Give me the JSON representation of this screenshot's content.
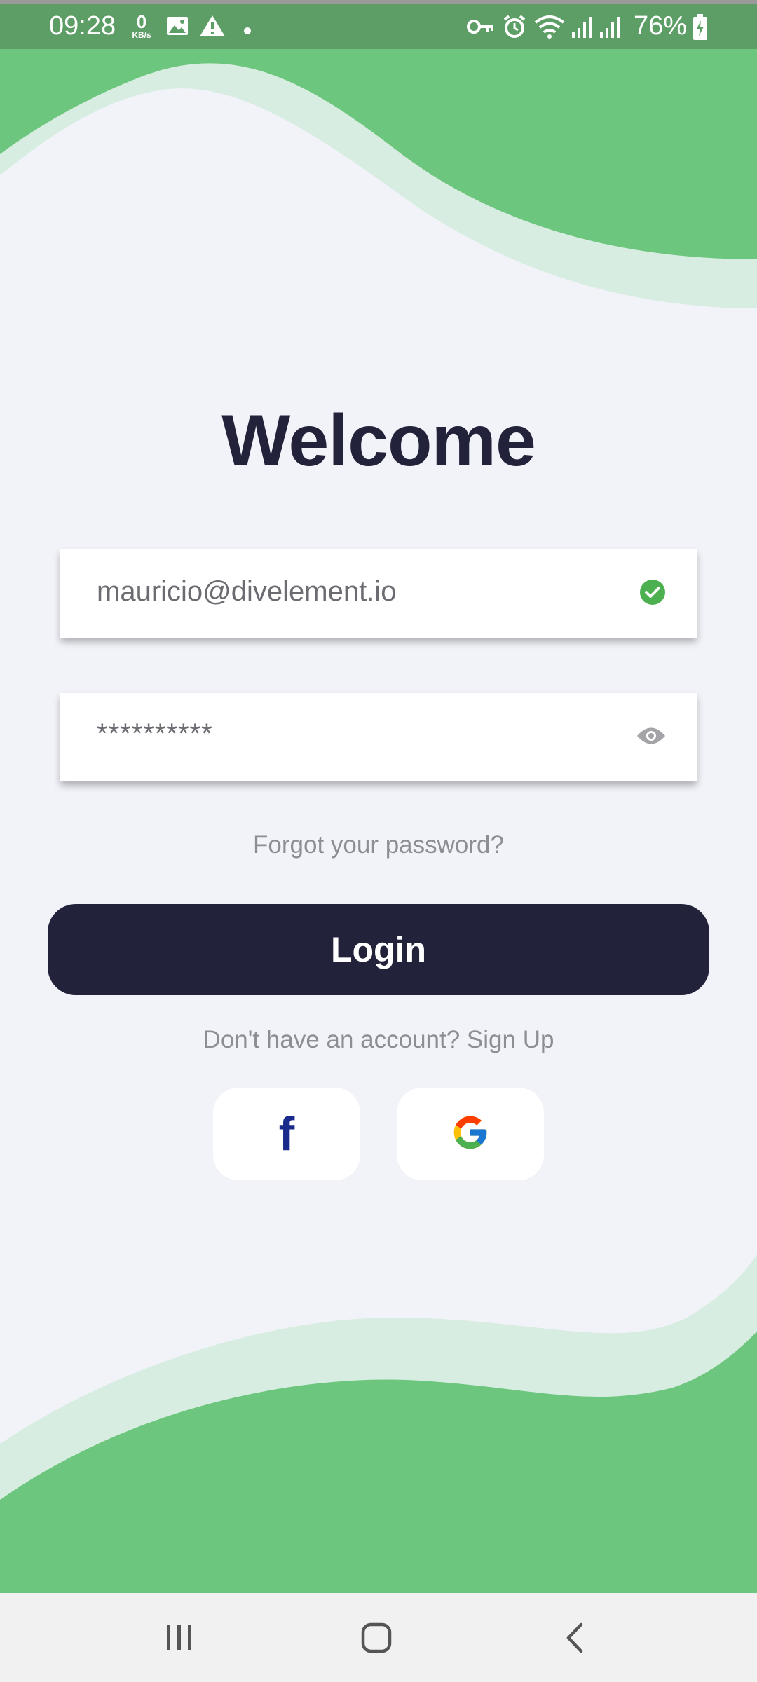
{
  "status_bar": {
    "time": "09:28",
    "network_speed_value": "0",
    "network_speed_unit": "KB/s",
    "battery": "76%",
    "icons": [
      "image-icon",
      "warning-icon",
      "dot-icon",
      "key-icon",
      "alarm-icon",
      "wifi-icon",
      "signal-icon",
      "signal-icon",
      "battery-charging-icon"
    ]
  },
  "login": {
    "title": "Welcome",
    "email_value": "mauricio@divelement.io",
    "password_value": "**********",
    "forgot_password": "Forgot your password?",
    "login_button": "Login",
    "signup_prompt": "Don't have an account? Sign Up"
  },
  "social": {
    "facebook_icon": "facebook-icon",
    "google_icon": "google-icon"
  },
  "nav_bar": {
    "icons": [
      "recent-apps-icon",
      "home-icon",
      "back-icon"
    ]
  },
  "colors": {
    "accent_green": "#6dc67d",
    "light_green": "#d8ede1",
    "background": "#f2f3f9",
    "dark_navy": "#22223a",
    "check_green": "#4caf50"
  }
}
